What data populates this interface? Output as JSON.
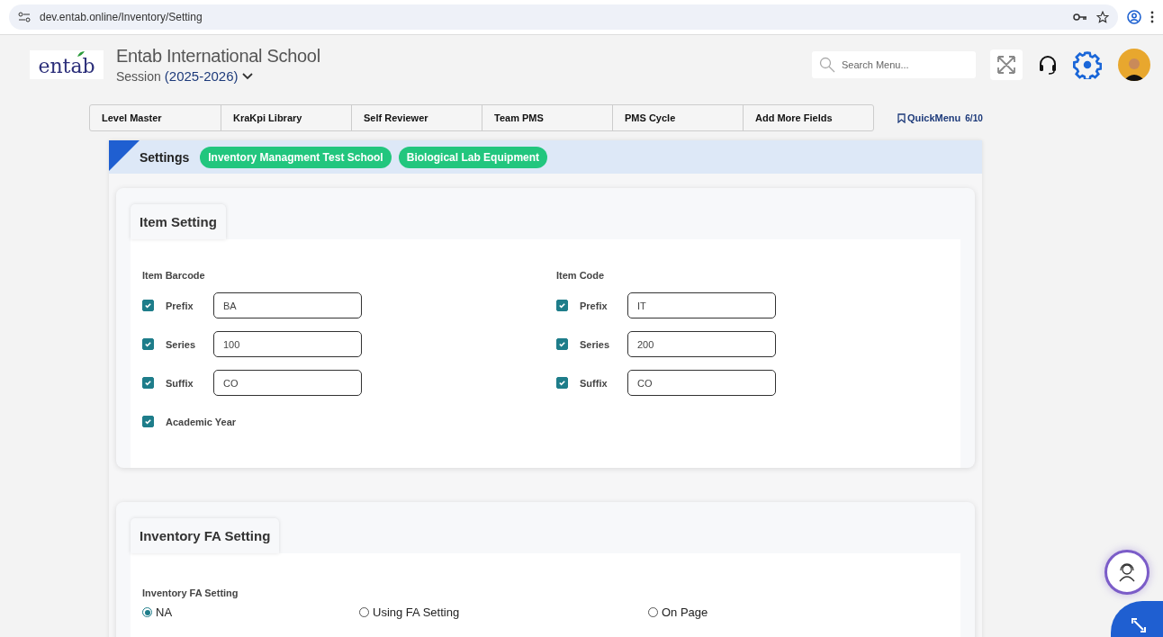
{
  "browser": {
    "url": "dev.entab.online/Inventory/Setting"
  },
  "header": {
    "logo": "entab",
    "school": "Entab International School",
    "session_label": "Session",
    "session_value": "(2025-2026)",
    "search": {
      "placeholder": "Search Menu..."
    }
  },
  "nav_tabs": [
    {
      "label": "Level Master",
      "selected": false
    },
    {
      "label": "KraKpi Library",
      "selected": false
    },
    {
      "label": "Self Reviewer",
      "selected": false
    },
    {
      "label": "Team PMS",
      "selected": false
    },
    {
      "label": "PMS Cycle",
      "selected": false
    },
    {
      "label": "Add More Fields",
      "selected": false
    }
  ],
  "quick_menu": {
    "label": "QuickMenu",
    "count": "6/10"
  },
  "breadcrumb": {
    "title": "Settings",
    "tags": [
      "Inventory Managment Test School",
      "Biological Lab Equipment"
    ]
  },
  "item_setting": {
    "title": "Item Setting",
    "groups": [
      {
        "label": "Item Barcode",
        "rows": [
          {
            "kind": "field",
            "label": "Prefix",
            "checked": true,
            "value": "BA"
          },
          {
            "kind": "field",
            "label": "Series",
            "checked": true,
            "value": "100"
          },
          {
            "kind": "field",
            "label": "Suffix",
            "checked": true,
            "value": "CO"
          },
          {
            "kind": "check",
            "label": "Academic Year",
            "checked": true
          }
        ]
      },
      {
        "label": "Item Code",
        "rows": [
          {
            "kind": "field",
            "label": "Prefix",
            "checked": true,
            "value": "IT"
          },
          {
            "kind": "field",
            "label": "Series",
            "checked": true,
            "value": "200"
          },
          {
            "kind": "field",
            "label": "Suffix",
            "checked": true,
            "value": "CO"
          }
        ]
      }
    ]
  },
  "fa_setting": {
    "title": "Inventory FA Setting",
    "label": "Inventory FA Setting",
    "options": [
      {
        "label": "NA",
        "selected": true
      },
      {
        "label": "Using FA Setting",
        "selected": false
      },
      {
        "label": "On Page",
        "selected": false
      }
    ]
  }
}
